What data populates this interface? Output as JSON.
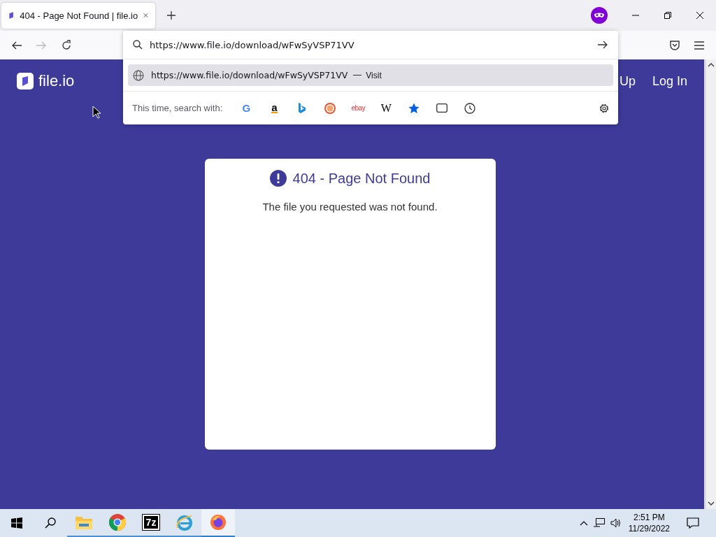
{
  "browser": {
    "tabs": [
      {
        "title": "404 - Page Not Found | file.io",
        "selected": true
      }
    ],
    "toolbar": {
      "back_disabled": false,
      "forward_disabled": true
    },
    "address_bar": {
      "value": "https://www.file.io/download/wFwSyVSP71VV"
    },
    "suggestions": [
      {
        "url": "https://www.file.io/download/wFwSyVSP71VV",
        "action": "Visit",
        "selected": true
      }
    ],
    "search_with": {
      "label": "This time, search with:",
      "engines": [
        {
          "kind": "google",
          "label": "G"
        },
        {
          "kind": "amazon",
          "label": "a"
        },
        {
          "kind": "bing"
        },
        {
          "kind": "duckduckgo"
        },
        {
          "kind": "ebay",
          "label": "ebay"
        },
        {
          "kind": "wikipedia",
          "label": "W"
        },
        {
          "kind": "bookmarks"
        },
        {
          "kind": "tabs"
        },
        {
          "kind": "history"
        }
      ]
    }
  },
  "page": {
    "logo": "file.io",
    "nav": [
      "Up",
      "Log In"
    ],
    "error": {
      "title": "404 - Page Not Found",
      "message": "The file you requested was not found."
    }
  },
  "taskbar": {
    "apps": [
      {
        "kind": "explorer",
        "active": false
      },
      {
        "kind": "chrome",
        "active": false
      },
      {
        "kind": "sevenzip",
        "label": "7z",
        "active": false
      },
      {
        "kind": "ie",
        "active": false
      },
      {
        "kind": "firefox",
        "active": true
      }
    ],
    "time": "2:51 PM",
    "date": "11/29/2022"
  }
}
